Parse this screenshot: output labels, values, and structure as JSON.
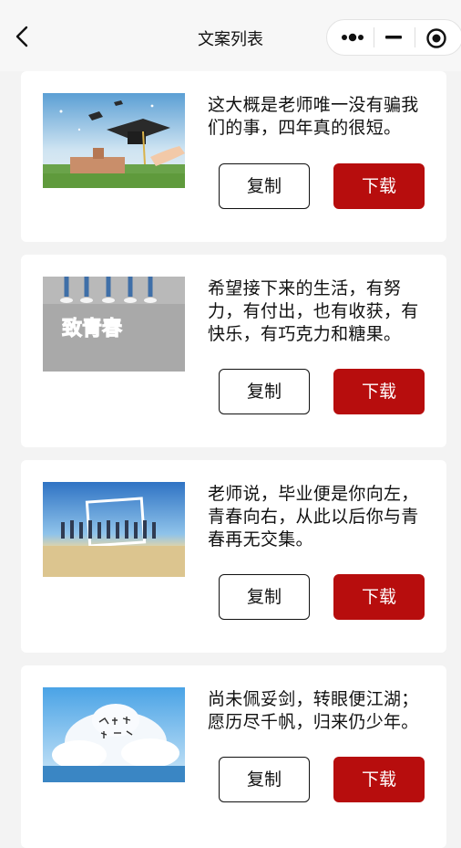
{
  "header": {
    "title": "文案列表"
  },
  "buttons": {
    "copy_label": "复制",
    "download_label": "下载"
  },
  "colors": {
    "accent": "#b70d0d",
    "background": "#f3f3f3"
  },
  "cards": [
    {
      "text": "这大概是老师唯一没有骗我们的事，四年真的很短。",
      "image": "graduation-cap-toss"
    },
    {
      "text": "希望接下来的生活，有努力，有付出，也有收获，有快乐，有巧克力和糖果。",
      "image": "youth-feet-poster",
      "image_text": "致青春"
    },
    {
      "text": "老师说，毕业便是你向左，青春向右，从此以后你与青春再无交集。",
      "image": "beach-group-photo"
    },
    {
      "text": "尚未佩妥剑，转眼便江湖；愿历尽千帆，归来仍少年。",
      "image": "clouds-calligraphy"
    }
  ]
}
